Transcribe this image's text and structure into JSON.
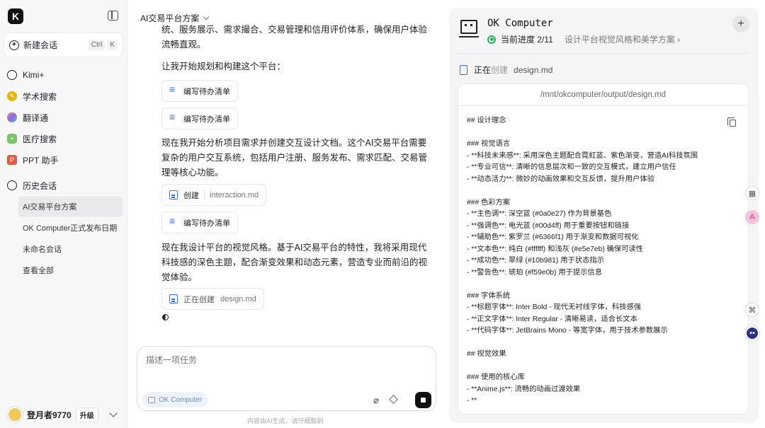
{
  "sidebar": {
    "logo": "K",
    "new_chat": {
      "label": "新建会话",
      "shortcut": [
        "Ctrl",
        "K"
      ]
    },
    "nav": [
      {
        "label": "Kimi+",
        "icon": "kimi-plus-icon",
        "color": "#222222"
      },
      {
        "label": "学术搜索",
        "icon": "academic-search-icon",
        "color": "#e8b400"
      },
      {
        "label": "翻译通",
        "icon": "translate-icon",
        "color": "#8a6bd8"
      },
      {
        "label": "医疗搜索",
        "icon": "medical-search-icon",
        "color": "#7cc46a"
      },
      {
        "label": "PPT 助手",
        "icon": "ppt-icon",
        "color": "#e25b45"
      }
    ],
    "history_header": "历史会话",
    "history": [
      {
        "label": "AI交易平台方案",
        "active": true
      },
      {
        "label": "OK Computer正式发布日期",
        "active": false
      },
      {
        "label": "未命名会话",
        "active": false
      },
      {
        "label": "查看全部",
        "active": false
      }
    ],
    "user": {
      "name": "登月者9770",
      "upgrade": "升级"
    }
  },
  "chat": {
    "title": "AI交易平台方案",
    "msg0": "统、服务展示、需求撮合、交易管理和信用评价体系，确保用户体验流畅直观。",
    "msg1": "让我开始规划和构建这个平台：",
    "todo1": "编写待办清单",
    "todo2": "编写待办清单",
    "msg2": "现在我开始分析项目需求并创建交互设计文档。这个AI交易平台需要复杂的用户交互系统，包括用户注册、服务发布、需求匹配、交易管理等核心功能。",
    "create_chip": {
      "action": "创建",
      "file": "interaction.md"
    },
    "todo3": "编写待办清单",
    "msg3": "现在我设计平台的视觉风格。基于AI交易平台的特性，我将采用现代科技感的深色主题，配合渐变效果和动态元素，营造专业而前沿的视觉体验。",
    "creating_chip": {
      "action": "正在创建",
      "file": "design.md"
    },
    "input_placeholder": "描述一项任务",
    "agent_tag": "OK Computer",
    "disclaimer": "内容由AI生成，请仔细甄别"
  },
  "panel": {
    "title": "OK Computer",
    "progress": "当前进度 2/11",
    "step": "设计平台视觉风格和美学方案 ›",
    "creating_a": "正在",
    "creating_b": "创建",
    "creating_file": "design.md",
    "path": "/mnt/okcomputer/output/design.md",
    "lines": [
      "## 设计理念",
      "",
      "### 视觉语言",
      "- **科技未来感**: 采用深色主题配合霓虹蓝、紫色渐变，营造AI科技氛围",
      "- **专业可信**: 清晰的信息层次和一致的交互模式，建立用户信任",
      "- **动态活力**: 微妙的动画效果和交互反馈，提升用户体验",
      "",
      "### 色彩方案",
      "- **主色调**: 深空蓝 (#0a0e27) 作为背景基色",
      "- **强调色**: 电光蓝 (#00d4ff) 用于重要按钮和链接",
      "- **辅助色**: 紫罗兰 (#6366f1) 用于渐变和数据可视化",
      "- **文本色**: 纯白 (#ffffff) 和浅灰 (#e5e7eb) 确保可读性",
      "- **成功色**: 翠绿 (#10b981) 用于状态指示",
      "- **警告色**: 琥珀 (#f59e0b) 用于提示信息",
      "",
      "### 字体系统",
      "- **标题字体**: Inter Bold - 现代无衬线字体，科技感强",
      "- **正文字体**: Inter Regular - 清晰易读，适合长文本",
      "- **代码字体**: JetBrains Mono - 等宽字体，用于技术参数展示",
      "",
      "## 视觉效果",
      "",
      "### 使用的核心库",
      "- **Anime.js**: 流畅的动画过渡效果",
      "- **"
    ]
  }
}
